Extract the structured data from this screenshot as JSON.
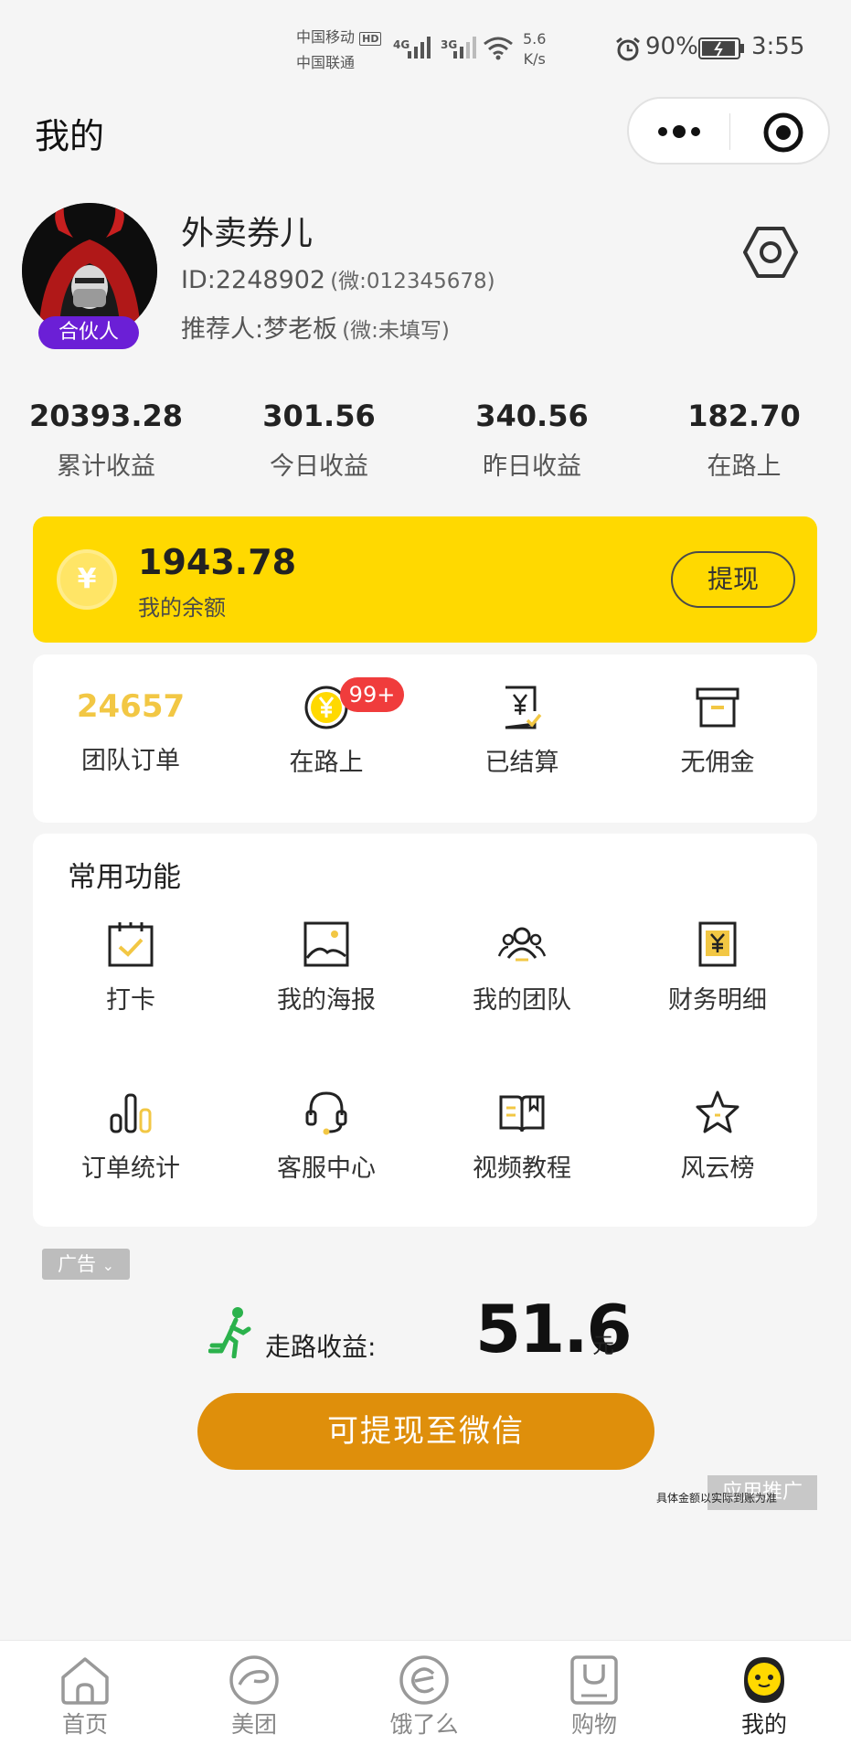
{
  "status_bar": {
    "carrier1": "中国移动",
    "carrier1_badge": "HD",
    "carrier2": "中国联通",
    "sig1": "4G",
    "sig2": "3G",
    "speed": "5.6",
    "speed_unit": "K/s",
    "battery": "90%",
    "time": "3:55"
  },
  "header": {
    "title": "我的",
    "more_icon": "more-dots-icon",
    "close_icon": "target-icon"
  },
  "profile": {
    "name": "外卖券儿",
    "id_line": "ID:2248902",
    "id_wechat": "(微:012345678)",
    "referrer": "推荐人:梦老板",
    "referrer_wechat": "(微:未填写)",
    "badge": "合伙人",
    "settings_icon": "hexagon-settings-icon"
  },
  "stats": [
    {
      "value": "20393.28",
      "label": "累计收益"
    },
    {
      "value": "301.56",
      "label": "今日收益"
    },
    {
      "value": "340.56",
      "label": "昨日收益"
    },
    {
      "value": "182.70",
      "label": "在路上"
    }
  ],
  "balance": {
    "amount": "1943.78",
    "label": "我的余额",
    "coin": "¥",
    "withdraw_label": "提现"
  },
  "orders": {
    "team_count": "24657",
    "team_label": "团队订单",
    "onroad_label": "在路上",
    "onroad_badge": "99+",
    "settled_label": "已结算",
    "nocomm_label": "无佣金"
  },
  "functions": {
    "title": "常用功能",
    "items": [
      {
        "label": "打卡",
        "icon": "checkin-calendar-icon"
      },
      {
        "label": "我的海报",
        "icon": "poster-image-icon"
      },
      {
        "label": "我的团队",
        "icon": "team-icon"
      },
      {
        "label": "财务明细",
        "icon": "finance-receipt-icon"
      },
      {
        "label": "订单统计",
        "icon": "bar-stats-icon"
      },
      {
        "label": "客服中心",
        "icon": "headset-icon"
      },
      {
        "label": "视频教程",
        "icon": "book-icon"
      },
      {
        "label": "风云榜",
        "icon": "star-icon"
      }
    ]
  },
  "ad": {
    "tag": "广告",
    "walk_label": "走路收益:",
    "walk_value": "51.6",
    "walk_unit": "元",
    "cta": "可提现至微信",
    "promo": "应用推广",
    "disclaimer": "具体金额以实际到账为准"
  },
  "tabbar": {
    "items": [
      {
        "label": "首页",
        "icon": "home-icon",
        "active": false
      },
      {
        "label": "美团",
        "icon": "meituan-icon",
        "active": false
      },
      {
        "label": "饿了么",
        "icon": "eleme-icon",
        "active": false
      },
      {
        "label": "购物",
        "icon": "shopping-bag-icon",
        "active": false
      },
      {
        "label": "我的",
        "icon": "mascot-icon",
        "active": true
      }
    ]
  },
  "colors": {
    "accent_yellow": "#ffd900",
    "cta_orange": "#df8f0b",
    "badge_purple": "#6b1fd6",
    "badge_red": "#f03c3c",
    "walk_green": "#2bb24c"
  }
}
